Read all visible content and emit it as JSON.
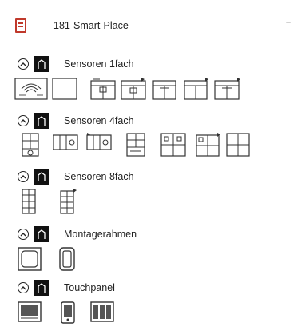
{
  "header": {
    "title": "181-Smart-Place"
  },
  "groups": [
    {
      "label": "Sensoren 1fach"
    },
    {
      "label": "Sensoren 4fach"
    },
    {
      "label": "Sensoren 8fach"
    },
    {
      "label": "Montagerahmen"
    },
    {
      "label": "Touchpanel"
    }
  ],
  "colors": {
    "accent": "#c0392b",
    "text": "#222222",
    "folder": "#111111"
  },
  "icons": {
    "header": "book-icon",
    "group_toggle": "collapse-up-icon",
    "group_folder": "folder-icon"
  }
}
